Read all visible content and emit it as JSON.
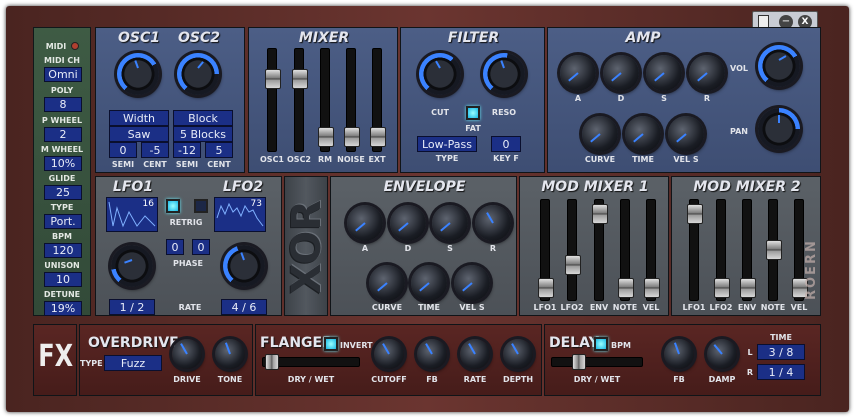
{
  "side": {
    "midi": "MIDI",
    "midi_ch": "MIDI CH",
    "midi_ch_val": "Omni",
    "poly": "POLY",
    "poly_val": "8",
    "p_wheel": "P WHEEL",
    "p_wheel_val": "2",
    "m_wheel": "M WHEEL",
    "m_wheel_val": "10%",
    "glide": "GLIDE",
    "glide_val": "25",
    "type": "TYPE",
    "type_val": "Port.",
    "bpm": "BPM",
    "bpm_val": "120",
    "unison": "UNISON",
    "unison_val": "10",
    "detune": "DETUNE",
    "detune_val": "19%"
  },
  "osc": {
    "osc1": "OSC1",
    "osc2": "OSC2",
    "width": "Width",
    "block": "Block",
    "saw": "Saw",
    "blocks": "5 Blocks",
    "semi1": "0",
    "cent1": "-5",
    "semi2": "-12",
    "cent2": "5",
    "semi_lbl": "SEMI",
    "cent_lbl": "CENT"
  },
  "mixer": {
    "title": "MIXER",
    "labels": [
      "OSC1",
      "OSC2",
      "RM",
      "NOISE",
      "EXT"
    ]
  },
  "filter": {
    "title": "FILTER",
    "cut": "CUT",
    "reso": "RESO",
    "fat": "FAT",
    "type_val": "Low-Pass",
    "type_lbl": "TYPE",
    "keyf_val": "0",
    "keyf_lbl": "KEY F"
  },
  "amp": {
    "title": "AMP",
    "a": "A",
    "d": "D",
    "s": "S",
    "r": "R",
    "curve": "CURVE",
    "time": "TIME",
    "vels": "VEL S",
    "vol": "VOL",
    "pan": "PAN"
  },
  "lfo": {
    "lfo1": "LFO1",
    "lfo2": "LFO2",
    "wave1": "16",
    "wave2": "73",
    "retrig": "RETRIG",
    "phase1": "0",
    "phase2": "0",
    "phase_lbl": "PHASE",
    "rate1": "1 / 2",
    "rate2": "4 / 6",
    "rate_lbl": "RATE"
  },
  "logo": "XOR",
  "envelope": {
    "title": "ENVELOPE",
    "a": "A",
    "d": "D",
    "s": "S",
    "r": "R",
    "curve": "CURVE",
    "time": "TIME",
    "vels": "VEL S"
  },
  "modmix1": {
    "title": "MOD MIXER 1",
    "labels": [
      "LFO1",
      "LFO2",
      "ENV",
      "NOTE",
      "VEL"
    ]
  },
  "modmix2": {
    "title": "MOD MIXER 2",
    "labels": [
      "LFO1",
      "LFO2",
      "ENV",
      "NOTE",
      "VEL"
    ]
  },
  "brand": "ROERN",
  "fx": {
    "logo": "FX",
    "overdrive": "OVERDRIVE",
    "type_lbl": "TYPE",
    "type_val": "Fuzz",
    "drive": "DRIVE",
    "tone": "TONE",
    "flanger": "FLANGER",
    "invert": "INVERT",
    "drywet": "DRY / WET",
    "cutoff": "CUTOFF",
    "fb": "FB",
    "rate": "RATE",
    "depth": "DEPTH",
    "delay": "DELAY",
    "bpm": "BPM",
    "delay_drywet": "DRY / WET",
    "delay_fb": "FB",
    "damp": "DAMP",
    "time": "TIME",
    "l": "L",
    "r": "R",
    "l_val": "3 / 8",
    "r_val": "1 / 4"
  },
  "window": {
    "close": "X"
  }
}
